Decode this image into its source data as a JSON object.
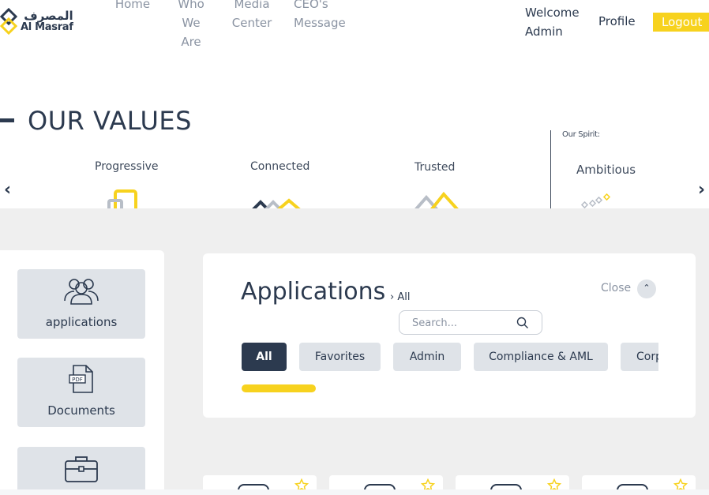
{
  "brand": {
    "name_ar": "المصرف",
    "name_en": "Al Masraf"
  },
  "nav": {
    "home": "Home",
    "who_we_are": "Who\nWe\nAre",
    "media_center": "Media\nCenter",
    "ceo_message": "CEO's\nMessage"
  },
  "user": {
    "welcome": "Welcome\nAdmin",
    "profile": "Profile",
    "logout": "Logout"
  },
  "values": {
    "title": "OUR VALUES",
    "items": [
      "Progressive",
      "Connected",
      "Trusted"
    ],
    "spirit_label": "Our Spirit:",
    "spirit_value": "Ambitious"
  },
  "sidebar": {
    "items": [
      {
        "label": "applications",
        "icon": "users-group-icon"
      },
      {
        "label": "Documents",
        "icon": "pdf-document-icon"
      },
      {
        "label": "",
        "icon": "briefcase-icon"
      }
    ]
  },
  "applications": {
    "title": "Applications",
    "breadcrumb": "› All",
    "close_label": "Close",
    "search_placeholder": "Search...",
    "tabs": [
      "All",
      "Favorites",
      "Admin",
      "Compliance & AML",
      "Corporate"
    ],
    "active_tab": "All"
  },
  "colors": {
    "navy": "#2c3a4f",
    "accent_yellow": "#f7d21e",
    "muted_gray": "#8a93a2",
    "card_gray": "#dfe3e8",
    "background_gray": "#efefef"
  }
}
